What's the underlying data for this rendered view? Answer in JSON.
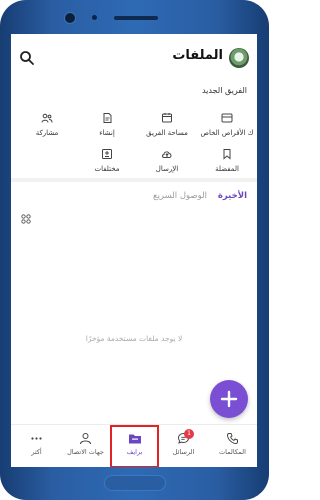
{
  "header": {
    "title": "الملفات"
  },
  "section": {
    "title": "الفريق الجديد"
  },
  "grid": [
    {
      "label": "ك الأقراص الخاص",
      "icon": "drive-icon"
    },
    {
      "label": "مساحة الفريق",
      "icon": "team-space-icon"
    },
    {
      "label": "إنشاء",
      "icon": "create-icon"
    },
    {
      "label": "مشاركة",
      "icon": "share-icon"
    },
    {
      "label": "المفضلة",
      "icon": "bookmark-icon"
    },
    {
      "label": "الإرسال",
      "icon": "upload-cloud-icon"
    },
    {
      "label": "مختلفات",
      "icon": "misc-icon"
    }
  ],
  "tabs": {
    "recent": "الأخيرة",
    "quick": "الوصول السريع"
  },
  "empty": {
    "text": "لا يوجد ملفات مستخدمة مؤخرًا"
  },
  "bottom_nav": [
    {
      "label": "المكالمات",
      "icon": "phone-icon"
    },
    {
      "label": "الرسائل",
      "icon": "chat-icon",
      "badge": "1"
    },
    {
      "label": "برايف",
      "icon": "folder-icon",
      "active": true
    },
    {
      "label": "جهات الاتصال",
      "icon": "contacts-icon"
    },
    {
      "label": "أكثر",
      "icon": "more-icon"
    }
  ],
  "colors": {
    "accent": "#7b4fd3",
    "badge": "#e63946",
    "highlight_box": "#e02424"
  }
}
